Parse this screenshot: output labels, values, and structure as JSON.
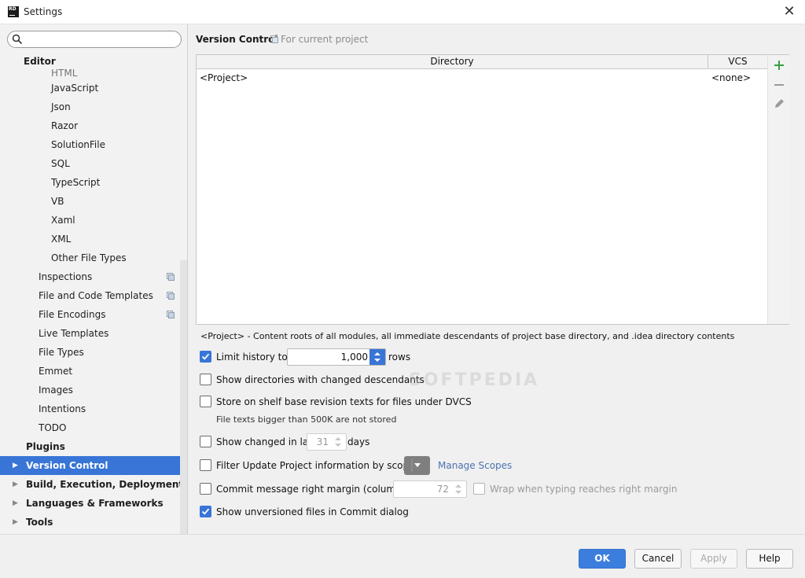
{
  "window": {
    "title": "Settings",
    "logo_text": "RD"
  },
  "sidebar": {
    "search": {
      "placeholder": "",
      "value": ""
    },
    "editor_label": "Editor",
    "cut_item": "HTML",
    "items": [
      {
        "label": "JavaScript"
      },
      {
        "label": "Json"
      },
      {
        "label": "Razor"
      },
      {
        "label": "SolutionFile"
      },
      {
        "label": "SQL"
      },
      {
        "label": "TypeScript"
      },
      {
        "label": "VB"
      },
      {
        "label": "Xaml"
      },
      {
        "label": "XML"
      },
      {
        "label": "Other File Types"
      },
      {
        "label": "Inspections"
      },
      {
        "label": "File and Code Templates"
      },
      {
        "label": "File Encodings"
      },
      {
        "label": "Live Templates"
      },
      {
        "label": "File Types"
      },
      {
        "label": "Emmet"
      },
      {
        "label": "Images"
      },
      {
        "label": "Intentions"
      },
      {
        "label": "TODO"
      },
      {
        "label": "Plugins"
      },
      {
        "label": "Version Control"
      },
      {
        "label": "Build, Execution, Deployment"
      },
      {
        "label": "Languages & Frameworks"
      },
      {
        "label": "Tools"
      }
    ]
  },
  "main": {
    "title": "Version Control",
    "scope_note": "For current project",
    "table": {
      "headers": {
        "directory": "Directory",
        "vcs": "VCS"
      },
      "rows": [
        {
          "directory": "<Project>",
          "vcs": "<none>"
        }
      ]
    },
    "description": "<Project> - Content roots of all modules, all immediate descendants of project base directory, and .idea directory contents",
    "options": {
      "limit_history": {
        "label": "Limit history to:",
        "value": "1,000",
        "suffix": "rows",
        "checked": true
      },
      "show_dirs": {
        "label": "Show directories with changed descendants",
        "checked": false
      },
      "store_shelf": {
        "label": "Store on shelf base revision texts for files under DVCS",
        "note": "File texts bigger than 500K are not stored",
        "checked": false
      },
      "show_changed": {
        "label": "Show changed in last",
        "value": "31",
        "suffix": "days",
        "checked": false
      },
      "filter_update": {
        "label": "Filter Update Project information by scope",
        "link": "Manage Scopes",
        "checked": false
      },
      "commit_margin": {
        "label": "Commit message right margin (columns):",
        "value": "72",
        "wrap_label": "Wrap when typing reaches right margin",
        "checked": false
      },
      "show_unversioned": {
        "label": "Show unversioned files in Commit dialog",
        "checked": true
      }
    }
  },
  "footer": {
    "ok": "OK",
    "cancel": "Cancel",
    "apply": "Apply",
    "help": "Help"
  },
  "watermark": "SOFTPEDIA",
  "colors": {
    "accent": "#3875d6",
    "selected_bg": "#3875d6",
    "add_icon": "#3aa040",
    "link": "#4a72b3"
  }
}
